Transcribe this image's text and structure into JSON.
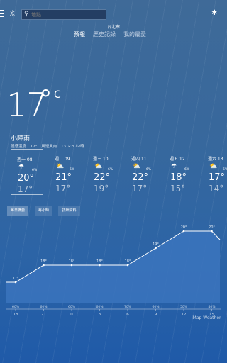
{
  "header": {
    "search_placeholder": "地點",
    "city": "台北市",
    "tabs": [
      {
        "label": "預報",
        "active": true
      },
      {
        "label": "歷史記錄",
        "active": false
      },
      {
        "label": "我的最愛",
        "active": false
      }
    ]
  },
  "current": {
    "temp": "17",
    "deg": "°",
    "unit": "C",
    "condition": "小陣雨",
    "details": [
      "體感溫度",
      "17°",
      "風速風向",
      "13 マイル/時"
    ]
  },
  "forecast": [
    {
      "day": "週一 08",
      "icon": "rain-icon",
      "pct": "6%",
      "hi": "20°",
      "lo": "17°",
      "selected": true
    },
    {
      "day": "週二 09",
      "icon": "partly-cloudy-icon",
      "pct": "6%",
      "hi": "21°",
      "lo": "17°",
      "selected": false
    },
    {
      "day": "週三 10",
      "icon": "partly-cloudy-icon",
      "pct": "6%",
      "hi": "22°",
      "lo": "19°",
      "selected": false
    },
    {
      "day": "週四 11",
      "icon": "partly-cloudy-icon",
      "pct": "6%",
      "hi": "22°",
      "lo": "17°",
      "selected": false
    },
    {
      "day": "週五 12",
      "icon": "rain-icon",
      "pct": "6%",
      "hi": "18°",
      "lo": "15°",
      "selected": false
    },
    {
      "day": "週六 13",
      "icon": "partly-cloudy-icon",
      "pct": "6%",
      "hi": "17°",
      "lo": "14°",
      "selected": false
    }
  ],
  "modes": [
    {
      "label": "每日摘要",
      "active": true
    },
    {
      "label": "每小時",
      "active": false
    },
    {
      "label": "詳細資料",
      "active": false
    }
  ],
  "chart_data": {
    "type": "area",
    "x": [
      "18",
      "21",
      "0",
      "3",
      "6",
      "9",
      "12",
      "15"
    ],
    "temps": [
      "17°",
      "18°",
      "18°",
      "18°",
      "18°",
      "19°",
      "20°",
      "20°"
    ],
    "values": [
      17,
      18,
      18,
      18,
      18,
      19,
      20,
      20
    ],
    "precip": [
      "60%",
      "60%",
      "60%",
      "60%",
      "70%",
      "60%",
      "50%",
      "40%"
    ]
  },
  "brand": "iMap Weather",
  "colors": {
    "chart_fill": "#3b74bd",
    "chart_line": "#ffffff"
  }
}
